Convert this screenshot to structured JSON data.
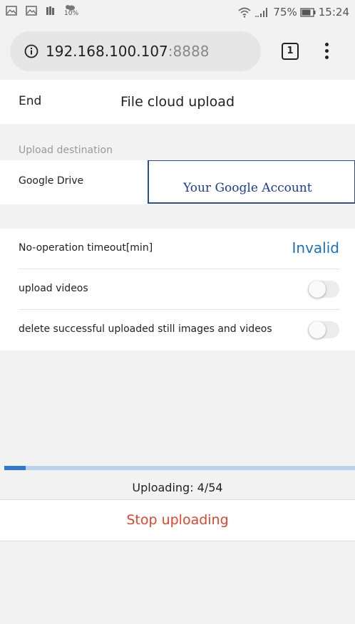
{
  "status_bar": {
    "weather_percent": "10%",
    "battery": "75%",
    "time": "15:24",
    "icons": [
      "image-icon",
      "image-icon",
      "book-icon",
      "weather-icon",
      "wifi-icon",
      "signal-icon",
      "battery-icon"
    ]
  },
  "browser": {
    "url_host": "192.168.100.107",
    "url_port": ":8888",
    "tab_count": "1",
    "icons": [
      "info-icon",
      "more-vert-icon"
    ]
  },
  "header": {
    "end_label": "End",
    "title": "File cloud upload"
  },
  "upload_destination": {
    "section_label": "Upload destination",
    "service_label": "Google Drive",
    "account_text": "Your Google Account"
  },
  "settings": {
    "timeout_label": "No-operation timeout[min]",
    "timeout_value": "Invalid",
    "upload_videos_label": "upload videos",
    "upload_videos_on": false,
    "delete_label": "delete successful uploaded still images and videos",
    "delete_on": false
  },
  "progress": {
    "completed": 4,
    "total": 54,
    "bar_fill_fraction": 0.06,
    "status_text": "Uploading: 4/54",
    "bar_color": "#2f79d2",
    "track_color": "#b9d3ef"
  },
  "actions": {
    "stop_label": "Stop uploading",
    "stop_color": "#e0442e"
  }
}
